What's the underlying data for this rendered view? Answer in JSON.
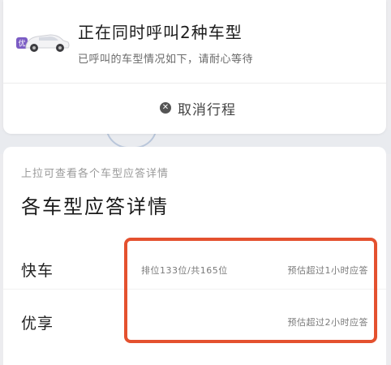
{
  "header": {
    "title": "正在同时呼叫2种车型",
    "subtitle": "已呼叫的车型情况如下，请耐心等待",
    "cancel_label": "取消行程",
    "logo_text": "优"
  },
  "details": {
    "pull_hint": "上拉可查看各个车型应答详情",
    "section_title": "各车型应答详情",
    "rows": [
      {
        "label": "快车",
        "rank": "排位133位/共165位",
        "eta": "预估超过1小时应答"
      },
      {
        "label": "优享",
        "rank": "",
        "eta": "预估超过2小时应答"
      }
    ]
  },
  "colors": {
    "highlight": "#e4512f",
    "logo_purple": "#7b5cc4"
  }
}
